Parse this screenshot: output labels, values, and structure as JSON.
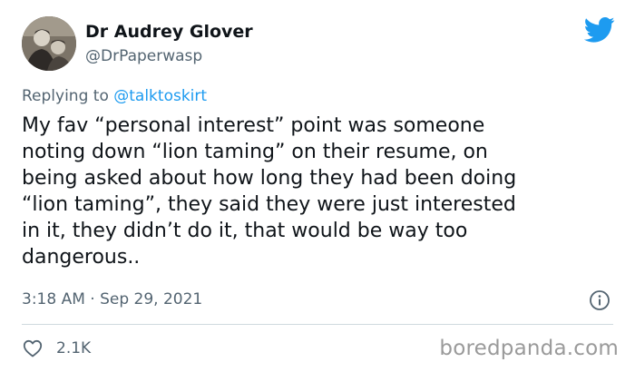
{
  "author": {
    "name": "Dr Audrey Glover",
    "handle": "@DrPaperwasp"
  },
  "reply": {
    "prefix": "Replying to ",
    "mention": "@talktoskirt"
  },
  "tweet": {
    "lines": [
      "My fav “personal interest” point was someone",
      "noting down “lion taming” on their resume, on",
      "being asked about how long they had been doing",
      "“lion taming”, they said they were just interested",
      "in it, they didn’t do it, that would be way too",
      "dangerous.."
    ],
    "timestamp": "3:18 AM · Sep 29, 2021"
  },
  "actions": {
    "like_count": "2.1K"
  },
  "watermark": "boredpanda.com",
  "icons": {
    "logo": "twitter-bird-icon",
    "info": "info-icon",
    "like": "heart-icon"
  },
  "colors": {
    "accent": "#1d9bf0",
    "text": "#0f1419",
    "secondary": "#536471",
    "divider": "#cfd9de"
  }
}
